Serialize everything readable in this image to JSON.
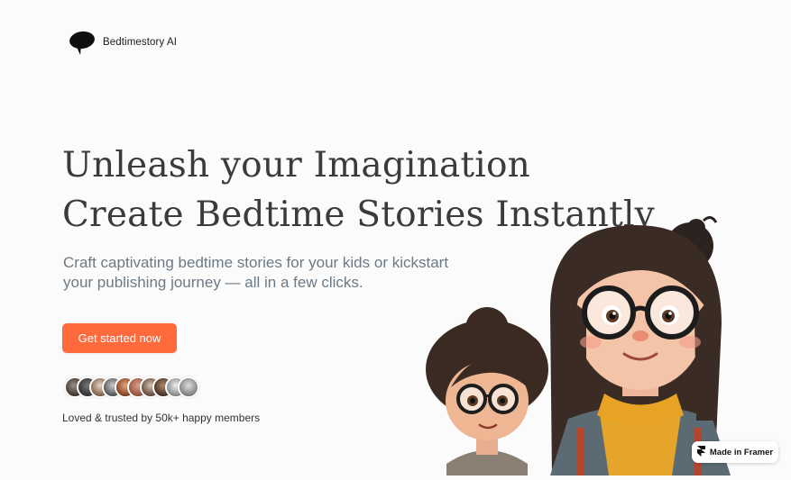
{
  "brand": {
    "name": "Bedtimestory AI",
    "logo_icon": "speech-bubble-icon"
  },
  "hero": {
    "title_line1": "Unleash your Imagination",
    "title_line2": "Create Bedtime Stories Instantly",
    "subtitle": "Craft captivating bedtime stories for your kids or kickstart your publishing journey — all in a few clicks.",
    "cta_label": "Get started now"
  },
  "social_proof": {
    "avatar_count": 10,
    "text": "Loved & trusted by 50k+ happy members"
  },
  "illustration": {
    "subject": "two cartoon children with glasses"
  },
  "framer_badge": {
    "label": "Made in Framer",
    "icon": "framer-icon"
  },
  "colors": {
    "accent": "#ff6a3d",
    "background": "#fbfbfb",
    "subtitle": "#6c7a86",
    "title": "#3b3b3b"
  }
}
